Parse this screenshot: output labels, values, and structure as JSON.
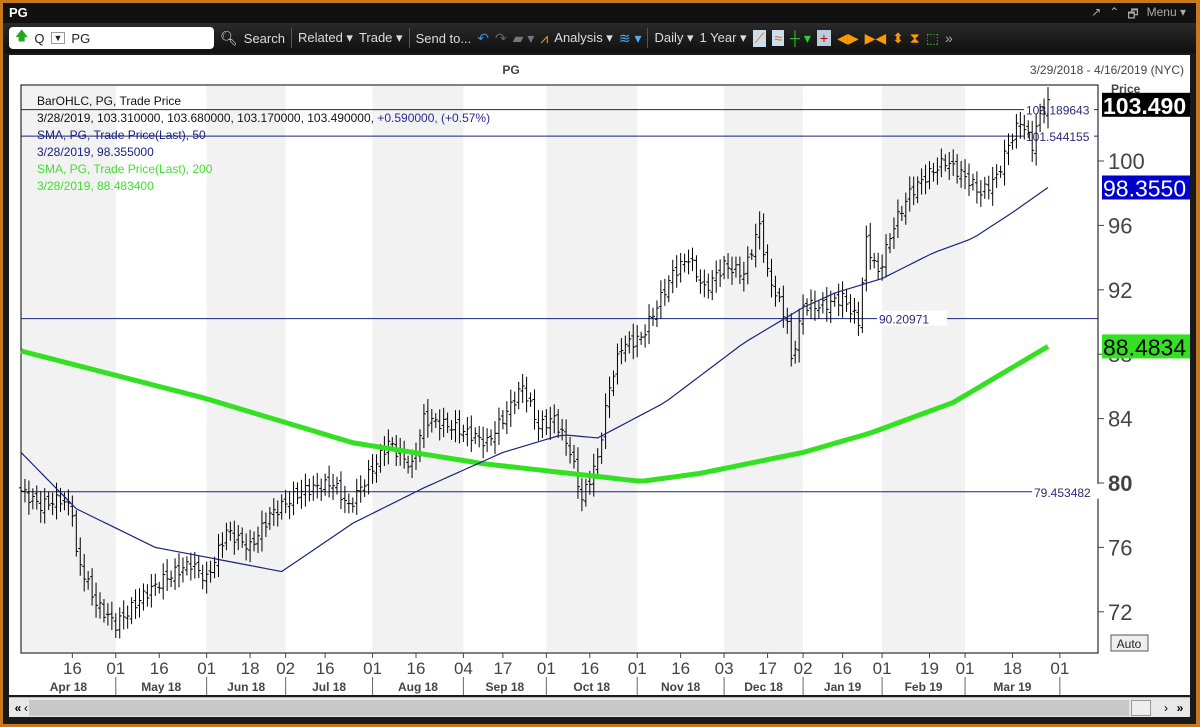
{
  "window": {
    "title": "PG",
    "controls": [
      "↗",
      "⌃",
      "🗗",
      "Menu ▾"
    ]
  },
  "toolbar": {
    "symbol_type": "Q",
    "symbol": "PG",
    "search": "Search",
    "related": "Related ▾",
    "trade": "Trade ▾",
    "send_to": "Send to...",
    "analysis": "Analysis ▾",
    "interval": "Daily ▾",
    "range": "1 Year ▾"
  },
  "chart": {
    "title": "PG",
    "date_range": "3/29/2018 - 4/16/2019 (NYC)",
    "price_label": "Price",
    "auto_label": "Auto",
    "legend": {
      "l1": "BarOHLC, PG, Trade Price",
      "l2a": "3/28/2019, 103.310000, 103.680000, 103.170000, 103.490000, ",
      "l2b": "+0.590000, (+0.57%)",
      "l3": "SMA, PG, Trade Price(Last),  50",
      "l4": "3/28/2019, 98.355000",
      "l5": "SMA, PG, Trade Price(Last),  200",
      "l6": "3/28/2019, 88.483400"
    },
    "colors": {
      "bars": "#000000",
      "sma50": "#1a237e",
      "sma200": "#33e022",
      "hline": "#1a237e",
      "last_bg": "#000000",
      "sma50_bg": "#0000cc",
      "sma200_bg": "#33e022"
    }
  },
  "chart_data": {
    "type": "line",
    "title": "PG",
    "xlabel": "",
    "ylabel": "Price",
    "ylim": [
      70,
      105
    ],
    "yticks": [
      72,
      76,
      80,
      84,
      88,
      92,
      96,
      100
    ],
    "x_day_ticks": [
      {
        "d": 13,
        "l": "16"
      },
      {
        "d": 24,
        "l": "01"
      },
      {
        "d": 35,
        "l": "16"
      },
      {
        "d": 47,
        "l": "01"
      },
      {
        "d": 58,
        "l": "18"
      },
      {
        "d": 67,
        "l": "02"
      },
      {
        "d": 77,
        "l": "16"
      },
      {
        "d": 89,
        "l": "01"
      },
      {
        "d": 100,
        "l": "16"
      },
      {
        "d": 112,
        "l": "04"
      },
      {
        "d": 122,
        "l": "17"
      },
      {
        "d": 133,
        "l": "01"
      },
      {
        "d": 144,
        "l": "16"
      },
      {
        "d": 156,
        "l": "01"
      },
      {
        "d": 167,
        "l": "16"
      },
      {
        "d": 178,
        "l": "03"
      },
      {
        "d": 189,
        "l": "17"
      },
      {
        "d": 198,
        "l": "02"
      },
      {
        "d": 208,
        "l": "16"
      },
      {
        "d": 218,
        "l": "01"
      },
      {
        "d": 230,
        "l": "19"
      },
      {
        "d": 239,
        "l": "01"
      },
      {
        "d": 251,
        "l": "18"
      },
      {
        "d": 263,
        "l": "01"
      }
    ],
    "months": [
      {
        "s": 0,
        "e": 24,
        "l": "Apr 18"
      },
      {
        "s": 24,
        "e": 47,
        "l": "May 18"
      },
      {
        "s": 47,
        "e": 67,
        "l": "Jun 18"
      },
      {
        "s": 67,
        "e": 89,
        "l": "Jul 18"
      },
      {
        "s": 89,
        "e": 112,
        "l": "Aug 18"
      },
      {
        "s": 112,
        "e": 133,
        "l": "Sep 18"
      },
      {
        "s": 133,
        "e": 156,
        "l": "Oct 18"
      },
      {
        "s": 156,
        "e": 178,
        "l": "Nov 18"
      },
      {
        "s": 178,
        "e": 198,
        "l": "Dec 18"
      },
      {
        "s": 198,
        "e": 218,
        "l": "Jan 19"
      },
      {
        "s": 218,
        "e": 239,
        "l": "Feb 19"
      },
      {
        "s": 239,
        "e": 263,
        "l": "Mar 19"
      }
    ],
    "close_anchors": [
      [
        0,
        79.5
      ],
      [
        5,
        78.6
      ],
      [
        10,
        79
      ],
      [
        13,
        78.3
      ],
      [
        14,
        75.5
      ],
      [
        19,
        72.5
      ],
      [
        24,
        71.2
      ],
      [
        31,
        73
      ],
      [
        36,
        74
      ],
      [
        43,
        75
      ],
      [
        47,
        74
      ],
      [
        52,
        77
      ],
      [
        58,
        76
      ],
      [
        63,
        78
      ],
      [
        71,
        79.5
      ],
      [
        79,
        80
      ],
      [
        83,
        78.5
      ],
      [
        88,
        80.5
      ],
      [
        93,
        82.5
      ],
      [
        99,
        81
      ],
      [
        102,
        84
      ],
      [
        109,
        83.5
      ],
      [
        114,
        83
      ],
      [
        118,
        82.5
      ],
      [
        122,
        84
      ],
      [
        127,
        86
      ],
      [
        131,
        83.5
      ],
      [
        135,
        84
      ],
      [
        139,
        82
      ],
      [
        142,
        79
      ],
      [
        146,
        81.5
      ],
      [
        149,
        86
      ],
      [
        152,
        88.5
      ],
      [
        157,
        89
      ],
      [
        160,
        90.5
      ],
      [
        165,
        93
      ],
      [
        169,
        94
      ],
      [
        173,
        92
      ],
      [
        178,
        93.5
      ],
      [
        183,
        93
      ],
      [
        187,
        96
      ],
      [
        189,
        93
      ],
      [
        194,
        90
      ],
      [
        195,
        87.5
      ],
      [
        198,
        91
      ],
      [
        203,
        91
      ],
      [
        208,
        91.5
      ],
      [
        212,
        90
      ],
      [
        214,
        95
      ],
      [
        217,
        93
      ],
      [
        221,
        96
      ],
      [
        225,
        98
      ],
      [
        229,
        99
      ],
      [
        234,
        100
      ],
      [
        239,
        99
      ],
      [
        243,
        98
      ],
      [
        247,
        99
      ],
      [
        250,
        101
      ],
      [
        253,
        102.5
      ],
      [
        256,
        101
      ],
      [
        258,
        103
      ],
      [
        260,
        103.5
      ]
    ],
    "sma50": [
      [
        0,
        81.9
      ],
      [
        14,
        78.4
      ],
      [
        34,
        76
      ],
      [
        66,
        74.5
      ],
      [
        84,
        77.5
      ],
      [
        102,
        79.7
      ],
      [
        122,
        81.9
      ],
      [
        137,
        83
      ],
      [
        146,
        82.8
      ],
      [
        163,
        85
      ],
      [
        183,
        88.7
      ],
      [
        198,
        90.9
      ],
      [
        206,
        91.8
      ],
      [
        218,
        92.7
      ],
      [
        231,
        94.3
      ],
      [
        241,
        95.2
      ],
      [
        251,
        96.8
      ],
      [
        260,
        98.355
      ]
    ],
    "sma200": [
      [
        0,
        88.2
      ],
      [
        46,
        85.3
      ],
      [
        84,
        82.5
      ],
      [
        117,
        81.2
      ],
      [
        157,
        80.1
      ],
      [
        172,
        80.6
      ],
      [
        198,
        81.9
      ],
      [
        215,
        83.1
      ],
      [
        236,
        85
      ],
      [
        260,
        88.4834
      ]
    ],
    "hlines": [
      {
        "v": 103.189643,
        "l": "103.189643"
      },
      {
        "v": 101.544155,
        "l": "101.544155"
      },
      {
        "v": 90.20971,
        "l": "90.20971"
      },
      {
        "v": 79.453482,
        "l": "79.453482"
      }
    ],
    "price_tags": {
      "last": "103.490",
      "sma50": "98.3550",
      "sma200": "88.4834"
    }
  }
}
